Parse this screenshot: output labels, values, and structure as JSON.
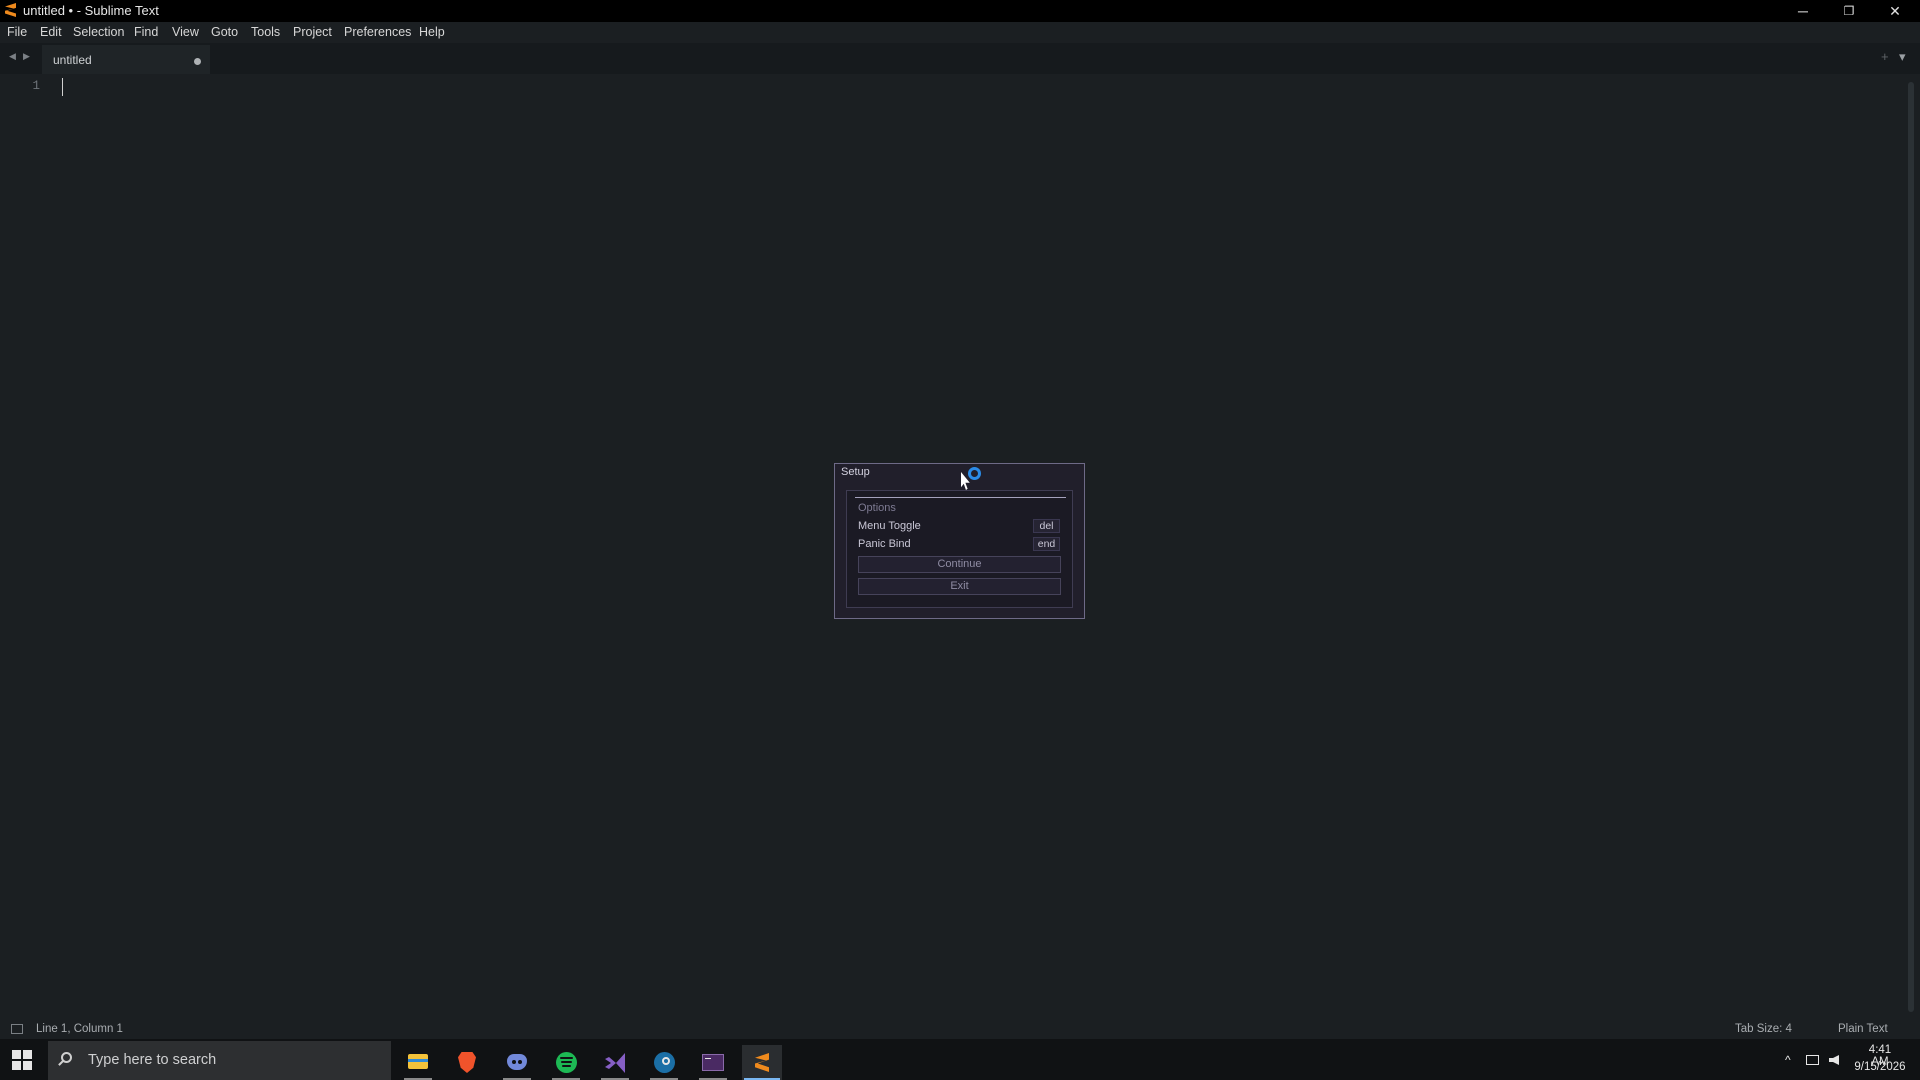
{
  "window": {
    "title": "untitled • - Sublime Text",
    "minimize": "─",
    "restore": "❐",
    "close": "✕"
  },
  "menu": [
    "File",
    "Edit",
    "Selection",
    "Find",
    "View",
    "Goto",
    "Tools",
    "Project",
    "Preferences",
    "Help"
  ],
  "tabs": {
    "back": "◀",
    "forward": "▶",
    "active_label": "untitled",
    "new_tab": "+",
    "overflow": "▾"
  },
  "editor": {
    "line_number": "1"
  },
  "dialog": {
    "title": "Setup",
    "section": "Options",
    "menu_toggle_label": "Menu Toggle",
    "menu_toggle_key": "del",
    "panic_bind_label": "Panic Bind",
    "panic_bind_key": "end",
    "continue_label": "Continue",
    "exit_label": "Exit"
  },
  "status": {
    "position": "Line 1, Column 1",
    "tab_size": "Tab Size: 4",
    "syntax": "Plain Text"
  },
  "taskbar": {
    "search_placeholder": "Type here to search",
    "apps": [
      "file-explorer-icon",
      "brave-icon",
      "discord-icon",
      "spotify-icon",
      "visual-studio-icon",
      "steam-icon",
      "terminal-icon",
      "sublime-text-icon"
    ],
    "time": "4:41 AM",
    "date": "9/15/2026",
    "tray_chevron": "^"
  },
  "colors": {
    "accent": "#ef8a1d",
    "editor_bg": "#1b1f22",
    "dialog_border": "#6e6a87",
    "spinner": "#2b8be6"
  }
}
